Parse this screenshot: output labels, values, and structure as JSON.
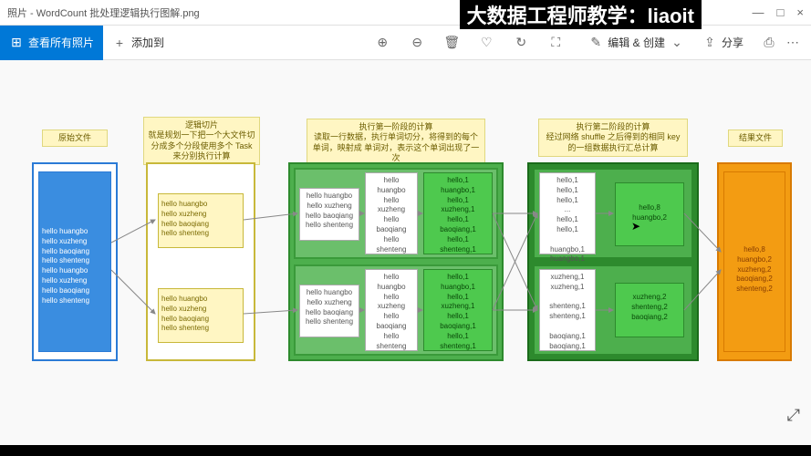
{
  "window": {
    "title": "照片 - WordCount 批处理逻辑执行图解.png",
    "min": "—",
    "max": "□",
    "close": "×"
  },
  "overlay": "大数据工程师教学：liaoit",
  "toolbar": {
    "viewAll": "查看所有照片",
    "addTo": "添加到",
    "edit": "编辑 & 创建",
    "share": "分享"
  },
  "icons": {
    "grid": "⊞",
    "plus": "+",
    "zoomIn": "⊕",
    "zoomOut": "⊖",
    "trash": "🗑",
    "heart": "♡",
    "rotate": "↻",
    "crop": "⛶",
    "chev": "⌄",
    "shareI": "⇪",
    "print": "⎙",
    "more": "⋯",
    "expand": "⤢"
  },
  "notes": {
    "n1": "原始文件",
    "n2": "逻辑切片\n就是规划一下把一个大文件切分成多个分段使用多个 Task 来分别执行计算",
    "n3": "执行第一阶段的计算\n读取一行数据，执行单词切分，将得到的每个单词，映射成 单词对，表示这个单词出现了一次",
    "n4": "执行第二阶段的计算\n经过网络 shuffle 之后得到的相同 key 的一组数据执行汇总计算",
    "n5": "结果文件"
  },
  "data": {
    "source": "hello huangbo\nhello xuzheng\nhello baoqiang\nhello shenteng\nhello huangbo\nhello xuzheng\nhello baoqiang\nhello shenteng",
    "split1": "hello huangbo\nhello xuzheng\nhello baoqiang\nhello shenteng",
    "split2": "hello huangbo\nhello xuzheng\nhello baoqiang\nhello shenteng",
    "m1a": "hello huangbo\nhello xuzheng\nhello baoqiang\nhello shenteng",
    "m1b": "hello\nhuangbo\nhello\nxuzheng\nhello\nbaoqiang\nhello\nshenteng",
    "m1c": "hello,1\nhuangbo,1\nhello,1\nxuzheng,1\nhello,1\nbaoqiang,1\nhello,1\nshenteng,1",
    "m2a": "hello huangbo\nhello xuzheng\nhello baoqiang\nhello shenteng",
    "m2b": "hello\nhuangbo\nhello\nxuzheng\nhello\nbaoqiang\nhello\nshenteng",
    "m2c": "hello,1\nhuangbo,1\nhello,1\nxuzheng,1\nhello,1\nbaoqiang,1\nhello,1\nshenteng,1",
    "r1a": "hello,1\nhello,1\nhello,1\n...\nhello,1\nhello,1\n\nhuangbo,1\nhuangbo,1",
    "r1b": "hello,8\nhuangbo,2",
    "r2a": "xuzheng,1\nxuzheng,1\n\nshenteng,1\nshenteng,1\n\nbaoqiang,1\nbaoqiang,1",
    "r2b": "xuzheng,2\nshenteng,2\nbaoqiang,2",
    "out": "hello,8\nhuangbo,2\nxuzheng,2\nbaoqiang,2\nshenteng,2"
  }
}
